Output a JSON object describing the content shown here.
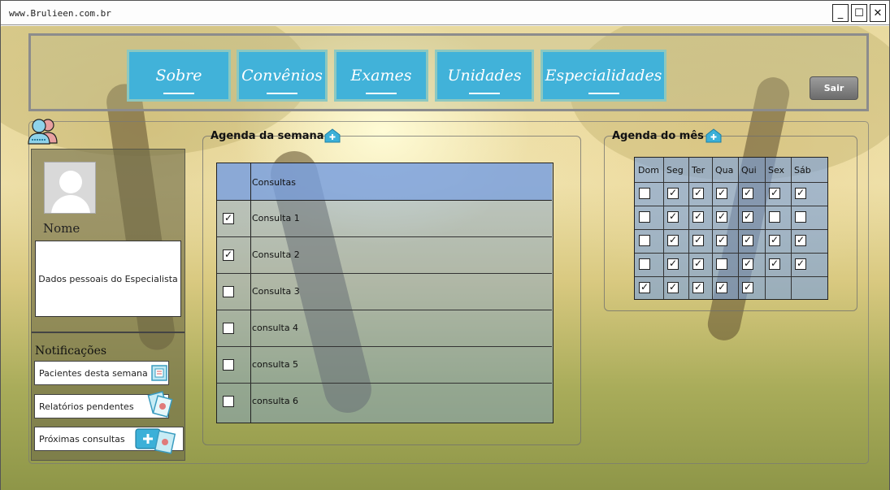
{
  "window": {
    "url": "www.Brulieen.com.br",
    "buttons": {
      "minimize": "_",
      "maximize": "☐",
      "close": "✕"
    }
  },
  "nav": {
    "items": [
      "Sobre",
      "Convênios",
      "Exames",
      "Unidades",
      "Especialidades"
    ],
    "logout_label": "Sair"
  },
  "profile": {
    "name_label": "Nome",
    "details_label": "Dados pessoais do Especialista"
  },
  "notifications": {
    "title": "Notificações",
    "items": [
      "Pacientes desta semana",
      "Relatórios pendentes",
      "Próximas consultas"
    ]
  },
  "week_agenda": {
    "title": "Agenda da semana",
    "column_header": "Consultas",
    "rows": [
      {
        "label": "Consulta 1",
        "checked": true
      },
      {
        "label": "Consulta 2",
        "checked": true
      },
      {
        "label": "Consulta 3",
        "checked": false
      },
      {
        "label": "consulta 4",
        "checked": false
      },
      {
        "label": "consulta 5",
        "checked": false
      },
      {
        "label": "consulta 6",
        "checked": false
      }
    ]
  },
  "month_agenda": {
    "title": "Agenda do mês",
    "days": [
      "Dom",
      "Seg",
      "Ter",
      "Qua",
      "Qui",
      "Sex",
      "Sáb"
    ],
    "grid": [
      [
        false,
        true,
        true,
        true,
        true,
        true,
        true
      ],
      [
        false,
        true,
        true,
        true,
        true,
        false,
        false
      ],
      [
        false,
        true,
        true,
        true,
        true,
        true,
        true
      ],
      [
        false,
        true,
        true,
        false,
        true,
        true,
        true
      ],
      [
        true,
        true,
        true,
        true,
        true,
        null,
        null
      ]
    ]
  },
  "colors": {
    "nav_button": "#41b2d9",
    "accent_icon": "#3bb0d8"
  }
}
